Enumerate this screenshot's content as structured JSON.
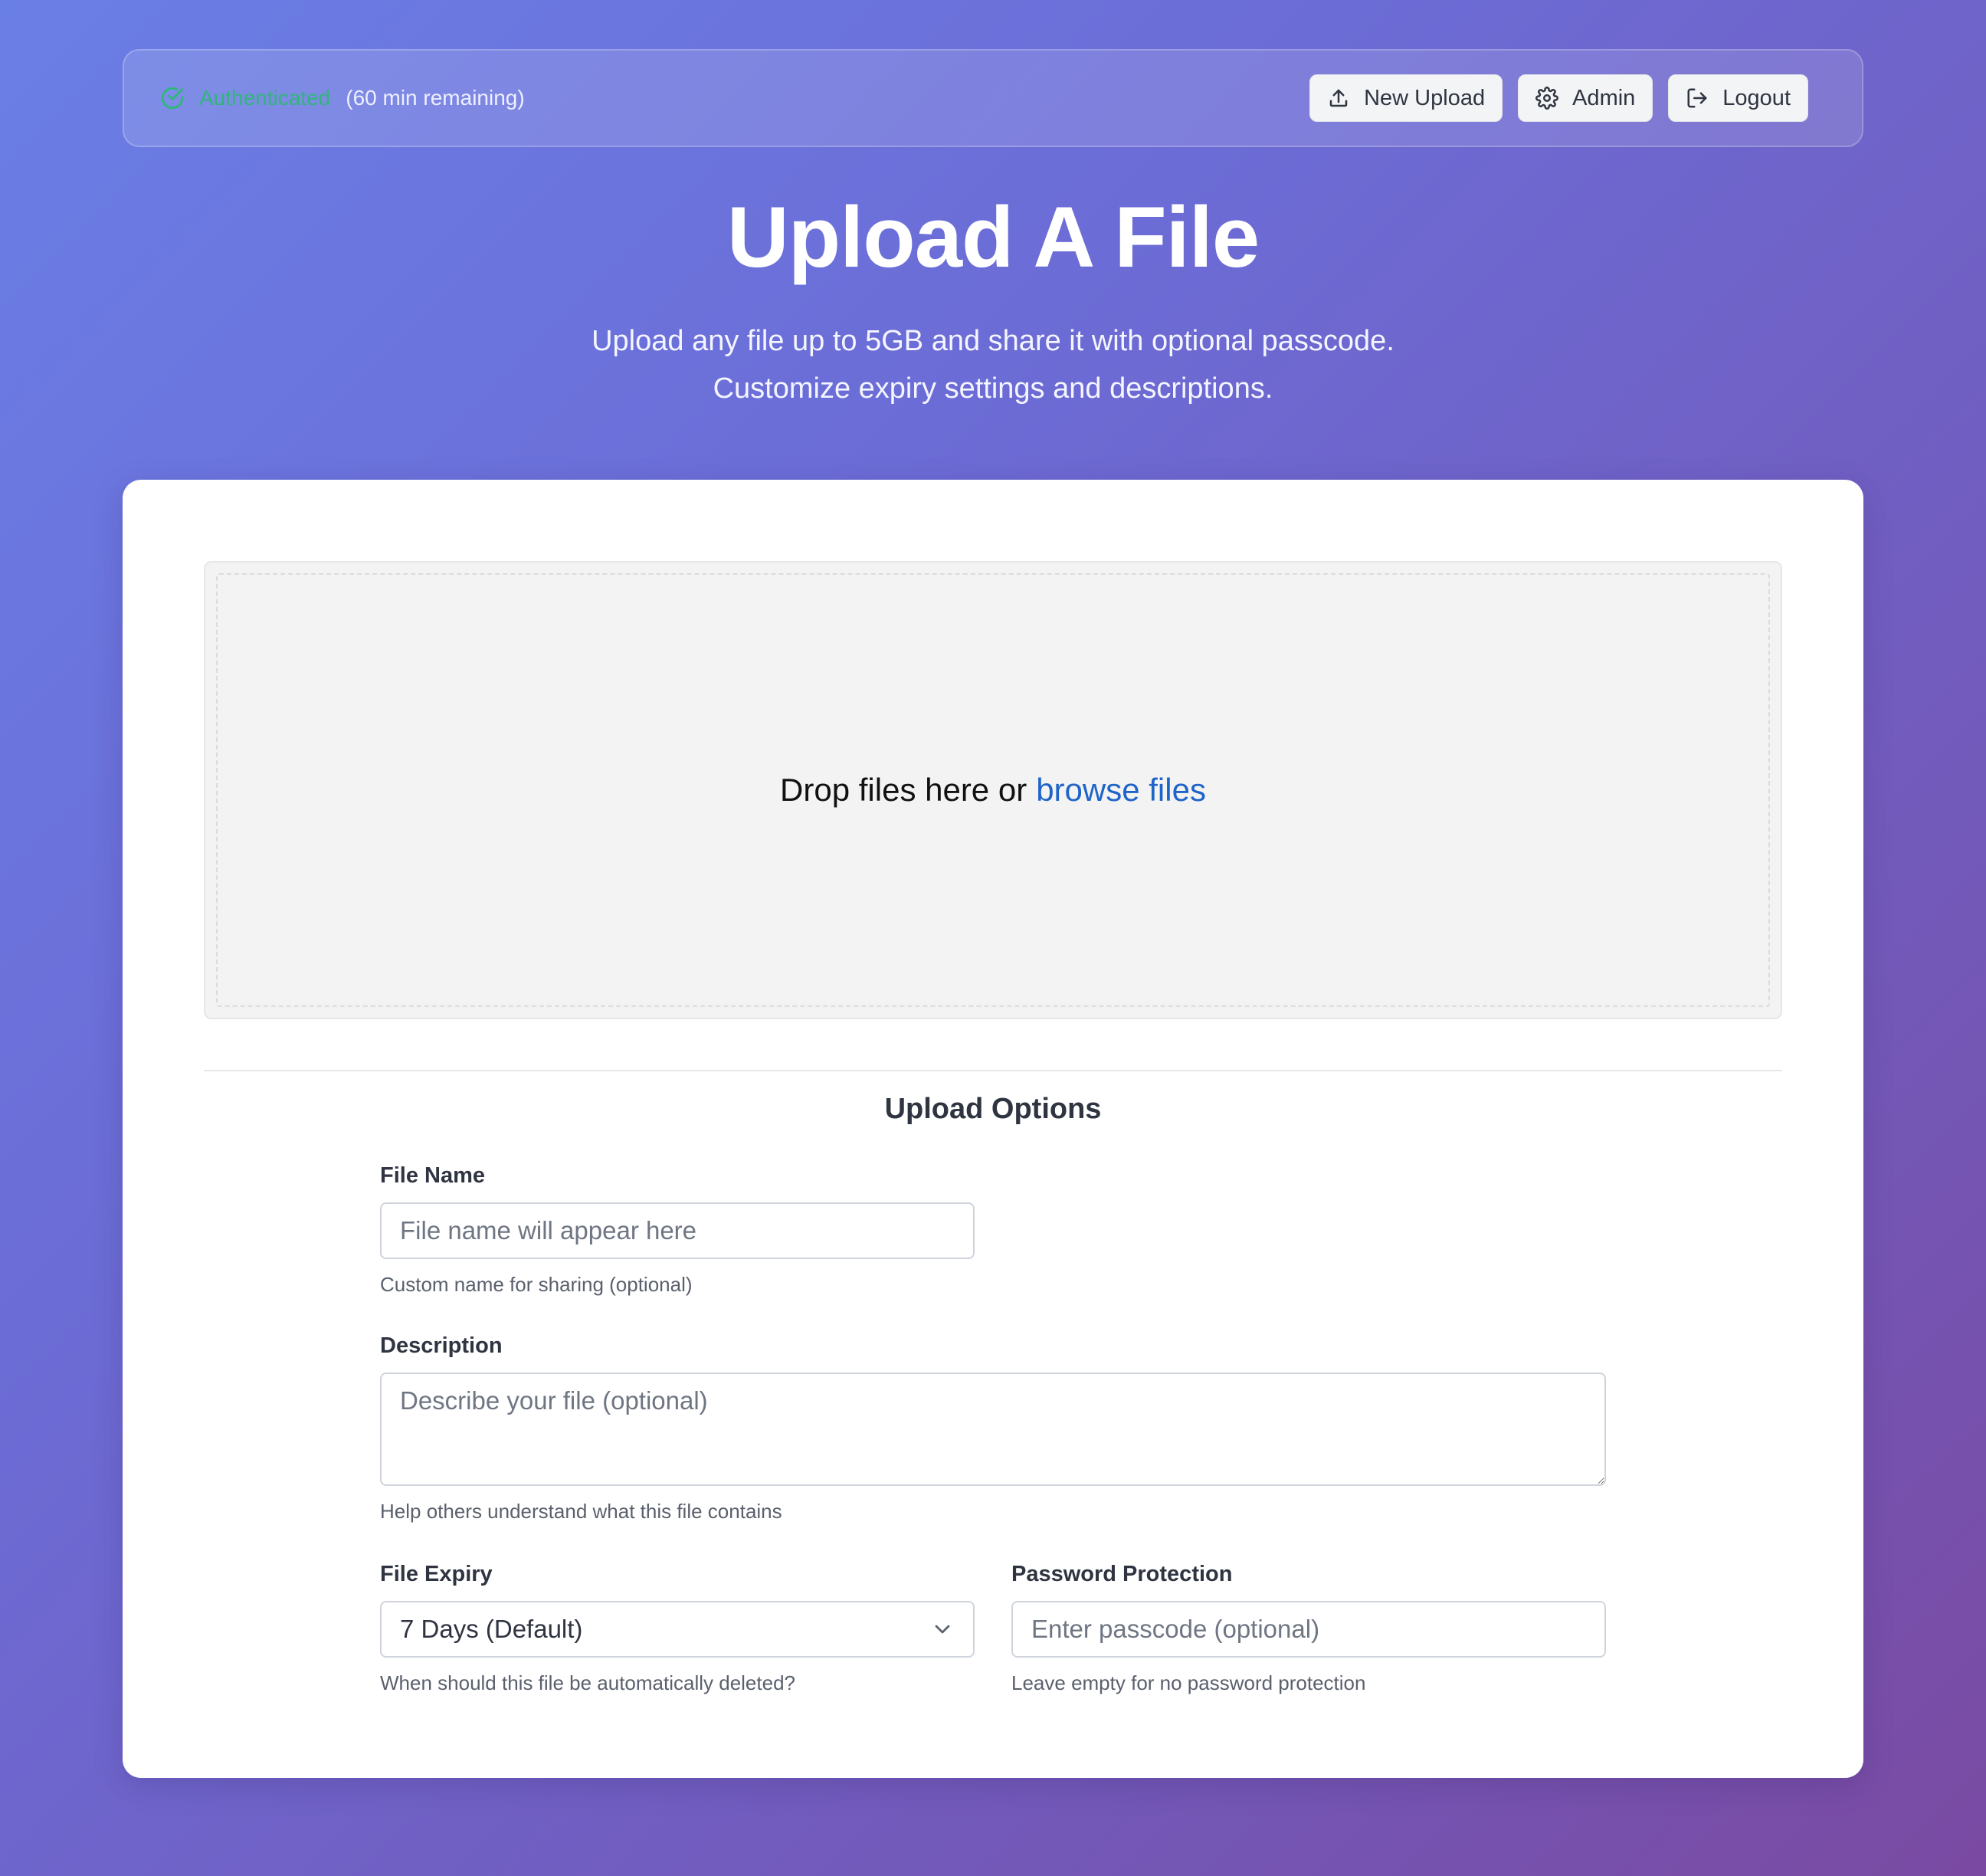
{
  "header": {
    "auth_status": "Authenticated",
    "auth_remaining": "(60 min remaining)",
    "buttons": {
      "new_upload": "New Upload",
      "admin": "Admin",
      "logout": "Logout"
    }
  },
  "hero": {
    "title": "Upload A File",
    "subtitle_line1": "Upload any file up to 5GB and share it with optional passcode.",
    "subtitle_line2": "Customize expiry settings and descriptions."
  },
  "dropzone": {
    "text": "Drop files here or",
    "link": "browse files"
  },
  "options": {
    "title": "Upload Options",
    "file_name": {
      "label": "File Name",
      "placeholder": "File name will appear here",
      "value": "",
      "hint": "Custom name for sharing (optional)"
    },
    "description": {
      "label": "Description",
      "placeholder": "Describe your file (optional)",
      "value": "",
      "hint": "Help others understand what this file contains"
    },
    "expiry": {
      "label": "File Expiry",
      "selected": "7 Days (Default)",
      "hint": "When should this file be automatically deleted?"
    },
    "password": {
      "label": "Password Protection",
      "placeholder": "Enter passcode (optional)",
      "value": "",
      "hint": "Leave empty for no password protection"
    }
  },
  "icons": {
    "auth": "check-circle-icon",
    "new_upload": "upload-icon",
    "admin": "gear-icon",
    "logout": "logout-icon",
    "select": "chevron-down-icon"
  },
  "colors": {
    "auth_green": "#2fb67a",
    "link_blue": "#1f64c8",
    "card_bg": "#ffffff",
    "dropzone_bg": "#f3f3f3"
  }
}
